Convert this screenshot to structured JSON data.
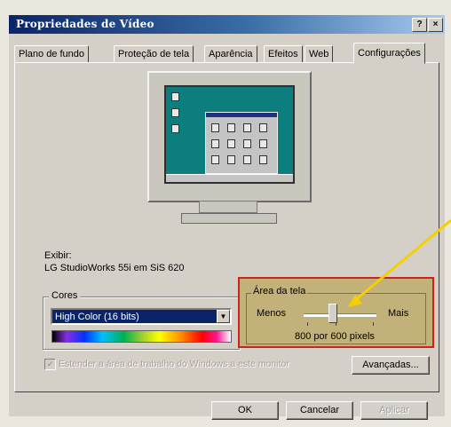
{
  "window": {
    "title": "Propriedades de Vídeo",
    "help_button": "?",
    "close_button": "×"
  },
  "tabs": [
    {
      "label": "Plano de fundo",
      "active": false
    },
    {
      "label": "Proteção de tela",
      "active": false
    },
    {
      "label": "Aparência",
      "active": false
    },
    {
      "label": "Efeitos",
      "active": false
    },
    {
      "label": "Web",
      "active": false
    },
    {
      "label": "Configurações",
      "active": true
    }
  ],
  "display": {
    "label": "Exibir:",
    "device": "LG StudioWorks 55i em SiS 620"
  },
  "colors_group": {
    "legend": "Cores",
    "selected": "High Color (16 bits)"
  },
  "screen_area": {
    "legend": "Área da tela",
    "less": "Menos",
    "more": "Mais",
    "resolution": "800 por 600 pixels",
    "slider_fraction": 0.4,
    "highlight_color": "#cc2222",
    "arrow_color": "#f5d000"
  },
  "extend_checkbox": {
    "label": "Estender a área de trabalho do Windows a este monitor",
    "checked": true,
    "enabled": false
  },
  "buttons": {
    "advanced": "Avançadas...",
    "ok": "OK",
    "cancel": "Cancelar",
    "apply": "Aplicar"
  }
}
